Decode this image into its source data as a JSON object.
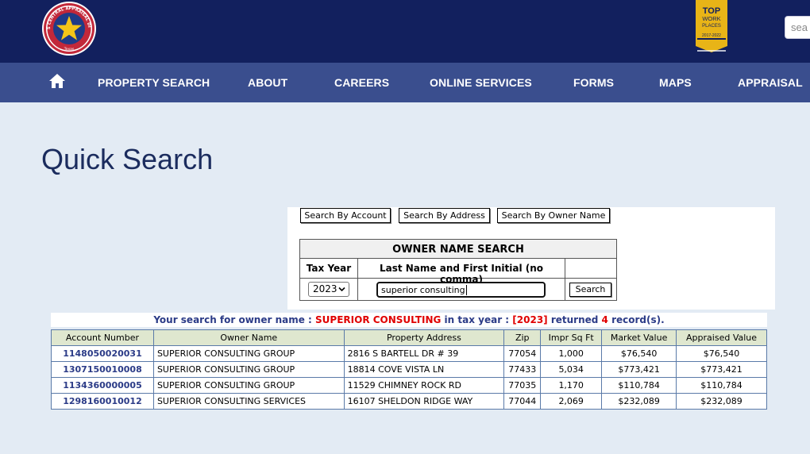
{
  "header": {
    "logo_text_top": "HARRIS CENTRAL APPRAISAL DISTRICT",
    "logo_text_bottom": "Texas",
    "badge": {
      "line1": "TOP",
      "line2": "WORK",
      "line3": "PLACES",
      "years": "2017-2022"
    },
    "search_placeholder": "sea"
  },
  "nav": {
    "home_icon": "home-icon",
    "items": [
      "PROPERTY SEARCH",
      "ABOUT",
      "CAREERS",
      "ONLINE SERVICES",
      "FORMS",
      "MAPS",
      "APPRAISAL"
    ]
  },
  "page_title": "Quick Search",
  "tabs": [
    "Search By Account",
    "Search By Address",
    "Search By Owner Name"
  ],
  "form": {
    "title": "OWNER NAME SEARCH",
    "col_year": "Tax Year",
    "col_name": "Last Name and First Initial (no comma)",
    "year_value": "2023",
    "owner_value": "superior consulting",
    "search_label": "Search"
  },
  "result_summary": {
    "part1": "Your search for owner name : ",
    "owner": "SUPERIOR CONSULTING",
    "part2": " in tax year : ",
    "year": "[2023]",
    "part3": " returned ",
    "count": "4",
    "part4": " record(s)."
  },
  "table": {
    "headers": [
      "Account Number",
      "Owner Name",
      "Property Address",
      "Zip",
      "Impr Sq Ft",
      "Market Value",
      "Appraised Value"
    ],
    "rows": [
      [
        "1148050020031",
        "SUPERIOR CONSULTING GROUP",
        "2816 S BARTELL DR # 39",
        "77054",
        "1,000",
        "$76,540",
        "$76,540"
      ],
      [
        "1307150010008",
        "SUPERIOR CONSULTING GROUP",
        "18814 COVE VISTA LN",
        "77433",
        "5,034",
        "$773,421",
        "$773,421"
      ],
      [
        "1134360000005",
        "SUPERIOR CONSULTING GROUP",
        "11529 CHIMNEY ROCK RD",
        "77035",
        "1,170",
        "$110,784",
        "$110,784"
      ],
      [
        "1298160010012",
        "SUPERIOR CONSULTING SERVICES",
        "16107 SHELDON RIDGE WAY",
        "77044",
        "2,069",
        "$232,089",
        "$232,089"
      ]
    ]
  },
  "colors": {
    "header_bg": "#12205e",
    "nav_bg": "#3a4e8e",
    "page_bg": "#e3ebf4",
    "accent_red": "#e00000",
    "link_blue": "#2b3b87"
  }
}
